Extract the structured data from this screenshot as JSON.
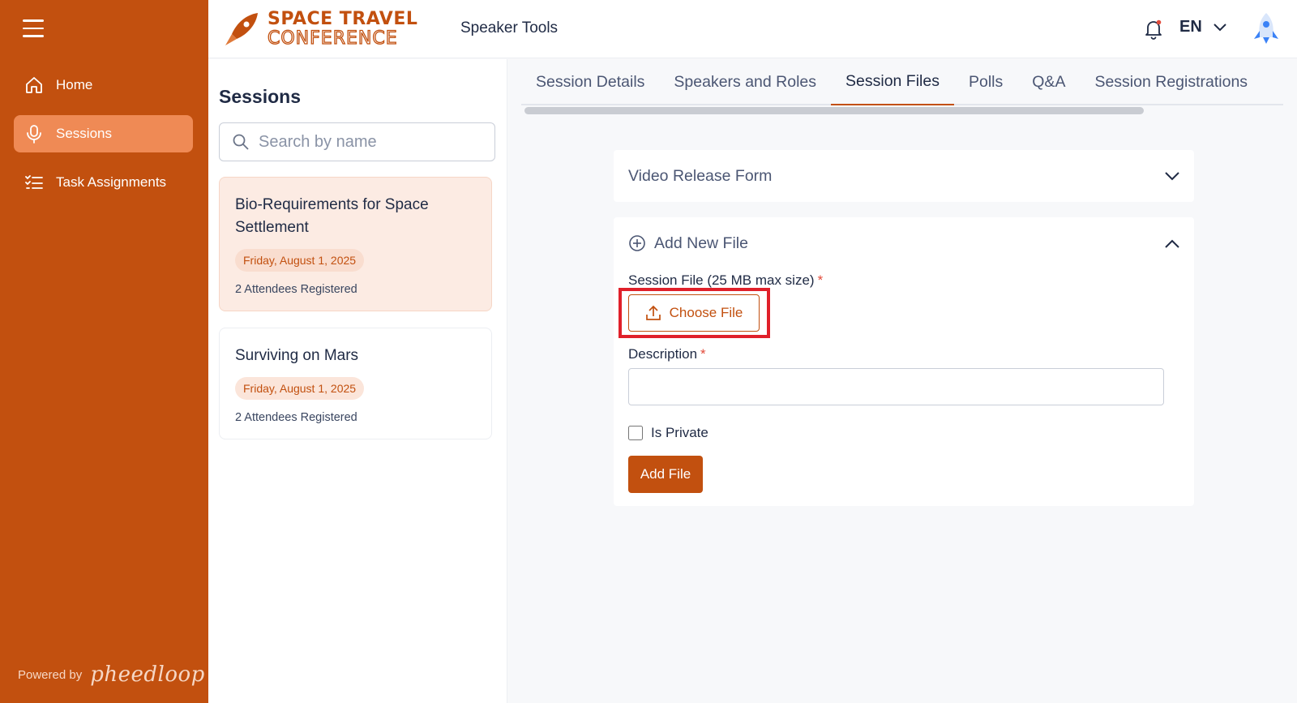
{
  "sidebar": {
    "items": [
      {
        "label": "Home",
        "icon": "home-icon"
      },
      {
        "label": "Sessions",
        "icon": "microphone-icon"
      },
      {
        "label": "Task Assignments",
        "icon": "task-list-icon"
      }
    ],
    "powered_label": "Powered by",
    "powered_brand": "pheedloop"
  },
  "header": {
    "logo_line1": "SPACE TRAVEL",
    "logo_line2": "CONFERENCE",
    "app_title": "Speaker Tools",
    "language": "EN"
  },
  "sessions": {
    "title": "Sessions",
    "search_placeholder": "Search by name",
    "cards": [
      {
        "title": "Bio-Requirements for Space Settlement",
        "date": "Friday, August 1, 2025",
        "attendees": "2 Attendees Registered"
      },
      {
        "title": "Surviving on Mars",
        "date": "Friday, August 1, 2025",
        "attendees": "2 Attendees Registered"
      }
    ]
  },
  "tabs": [
    "Session Details",
    "Speakers and Roles",
    "Session Files",
    "Polls",
    "Q&A",
    "Session Registrations"
  ],
  "active_tab": "Session Files",
  "accordion": {
    "video_release_title": "Video Release Form",
    "add_new_title": "Add New File",
    "session_file_label": "Session File (25 MB max size)",
    "choose_file_label": "Choose File",
    "description_label": "Description",
    "description_value": "",
    "private_label": "Is Private",
    "add_file_label": "Add File",
    "required_mark": "*"
  },
  "colors": {
    "brand": "#c2500f",
    "sidebar_active": "#ef8a55",
    "highlight": "#e0202a"
  }
}
